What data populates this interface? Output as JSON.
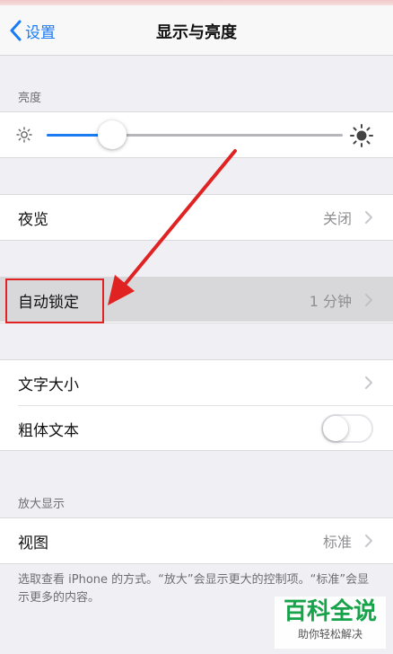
{
  "nav": {
    "back_label": "设置",
    "title": "显示与亮度"
  },
  "brightness": {
    "header": "亮度",
    "level_percent": 22
  },
  "night_shift": {
    "label": "夜览",
    "value": "关闭"
  },
  "auto_lock": {
    "label": "自动锁定",
    "value": "1 分钟"
  },
  "text_size": {
    "label": "文字大小"
  },
  "bold_text": {
    "label": "粗体文本",
    "enabled": false
  },
  "zoom": {
    "header": "放大显示",
    "view_label": "视图",
    "view_value": "标准"
  },
  "footer_note": "选取查看 iPhone 的方式。“放大”会显示更大的控制项。“标准”会显示更多的内容。",
  "watermark": {
    "main": "百科全说",
    "sub": "助你轻松解决"
  },
  "colors": {
    "accent": "#1a7bf2",
    "annotation": "#e02222",
    "watermark": "#16a34a"
  }
}
